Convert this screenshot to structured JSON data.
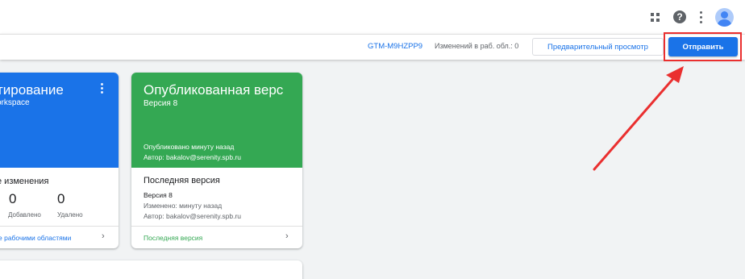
{
  "topbar": {
    "icons": [
      "apps-grid-icon",
      "help-icon",
      "more-vert-icon",
      "account-avatar-icon"
    ],
    "help_glyph": "?"
  },
  "subbar": {
    "container_id": "GTM-M9HZPP9",
    "workspace_changes": "Изменений в раб. обл.: 0",
    "preview_label": "Предварительный просмотр",
    "submit_label": "Отправить"
  },
  "workspace_card": {
    "title": "тирование",
    "subtitle": "orkspace",
    "changes_title": "е изменения",
    "added_count": "0",
    "added_label": "Добавлено",
    "removed_count": "0",
    "removed_label": "Удалено",
    "footer_link": "е рабочими областями",
    "header_color": "#1a73e8"
  },
  "published_card": {
    "title": "Опубликованная верс",
    "subtitle": "Версия 8",
    "published_line": "Опубликовано минуту назад",
    "author_line": "Автор: bakalov@serenity.spb.ru",
    "latest_title": "Последняя версия",
    "version_line": "Версия 8",
    "changed_line": "Изменено: минуту назад",
    "author_line_2": "Автор: bakalov@serenity.spb.ru",
    "footer_link": "Последняя версия",
    "header_color": "#34a853"
  },
  "annotation": {
    "color": "#ea2f2f"
  }
}
